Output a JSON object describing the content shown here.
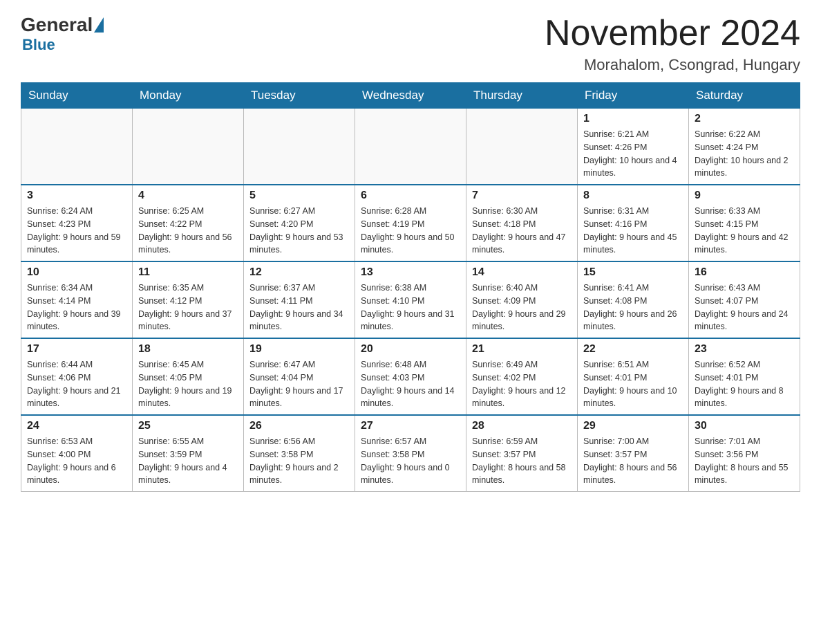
{
  "logo": {
    "general": "General",
    "blue": "Blue"
  },
  "header": {
    "month": "November 2024",
    "location": "Morahalom, Csongrad, Hungary"
  },
  "days_of_week": [
    "Sunday",
    "Monday",
    "Tuesday",
    "Wednesday",
    "Thursday",
    "Friday",
    "Saturday"
  ],
  "weeks": [
    [
      {
        "day": "",
        "info": ""
      },
      {
        "day": "",
        "info": ""
      },
      {
        "day": "",
        "info": ""
      },
      {
        "day": "",
        "info": ""
      },
      {
        "day": "",
        "info": ""
      },
      {
        "day": "1",
        "info": "Sunrise: 6:21 AM\nSunset: 4:26 PM\nDaylight: 10 hours and 4 minutes."
      },
      {
        "day": "2",
        "info": "Sunrise: 6:22 AM\nSunset: 4:24 PM\nDaylight: 10 hours and 2 minutes."
      }
    ],
    [
      {
        "day": "3",
        "info": "Sunrise: 6:24 AM\nSunset: 4:23 PM\nDaylight: 9 hours and 59 minutes."
      },
      {
        "day": "4",
        "info": "Sunrise: 6:25 AM\nSunset: 4:22 PM\nDaylight: 9 hours and 56 minutes."
      },
      {
        "day": "5",
        "info": "Sunrise: 6:27 AM\nSunset: 4:20 PM\nDaylight: 9 hours and 53 minutes."
      },
      {
        "day": "6",
        "info": "Sunrise: 6:28 AM\nSunset: 4:19 PM\nDaylight: 9 hours and 50 minutes."
      },
      {
        "day": "7",
        "info": "Sunrise: 6:30 AM\nSunset: 4:18 PM\nDaylight: 9 hours and 47 minutes."
      },
      {
        "day": "8",
        "info": "Sunrise: 6:31 AM\nSunset: 4:16 PM\nDaylight: 9 hours and 45 minutes."
      },
      {
        "day": "9",
        "info": "Sunrise: 6:33 AM\nSunset: 4:15 PM\nDaylight: 9 hours and 42 minutes."
      }
    ],
    [
      {
        "day": "10",
        "info": "Sunrise: 6:34 AM\nSunset: 4:14 PM\nDaylight: 9 hours and 39 minutes."
      },
      {
        "day": "11",
        "info": "Sunrise: 6:35 AM\nSunset: 4:12 PM\nDaylight: 9 hours and 37 minutes."
      },
      {
        "day": "12",
        "info": "Sunrise: 6:37 AM\nSunset: 4:11 PM\nDaylight: 9 hours and 34 minutes."
      },
      {
        "day": "13",
        "info": "Sunrise: 6:38 AM\nSunset: 4:10 PM\nDaylight: 9 hours and 31 minutes."
      },
      {
        "day": "14",
        "info": "Sunrise: 6:40 AM\nSunset: 4:09 PM\nDaylight: 9 hours and 29 minutes."
      },
      {
        "day": "15",
        "info": "Sunrise: 6:41 AM\nSunset: 4:08 PM\nDaylight: 9 hours and 26 minutes."
      },
      {
        "day": "16",
        "info": "Sunrise: 6:43 AM\nSunset: 4:07 PM\nDaylight: 9 hours and 24 minutes."
      }
    ],
    [
      {
        "day": "17",
        "info": "Sunrise: 6:44 AM\nSunset: 4:06 PM\nDaylight: 9 hours and 21 minutes."
      },
      {
        "day": "18",
        "info": "Sunrise: 6:45 AM\nSunset: 4:05 PM\nDaylight: 9 hours and 19 minutes."
      },
      {
        "day": "19",
        "info": "Sunrise: 6:47 AM\nSunset: 4:04 PM\nDaylight: 9 hours and 17 minutes."
      },
      {
        "day": "20",
        "info": "Sunrise: 6:48 AM\nSunset: 4:03 PM\nDaylight: 9 hours and 14 minutes."
      },
      {
        "day": "21",
        "info": "Sunrise: 6:49 AM\nSunset: 4:02 PM\nDaylight: 9 hours and 12 minutes."
      },
      {
        "day": "22",
        "info": "Sunrise: 6:51 AM\nSunset: 4:01 PM\nDaylight: 9 hours and 10 minutes."
      },
      {
        "day": "23",
        "info": "Sunrise: 6:52 AM\nSunset: 4:01 PM\nDaylight: 9 hours and 8 minutes."
      }
    ],
    [
      {
        "day": "24",
        "info": "Sunrise: 6:53 AM\nSunset: 4:00 PM\nDaylight: 9 hours and 6 minutes."
      },
      {
        "day": "25",
        "info": "Sunrise: 6:55 AM\nSunset: 3:59 PM\nDaylight: 9 hours and 4 minutes."
      },
      {
        "day": "26",
        "info": "Sunrise: 6:56 AM\nSunset: 3:58 PM\nDaylight: 9 hours and 2 minutes."
      },
      {
        "day": "27",
        "info": "Sunrise: 6:57 AM\nSunset: 3:58 PM\nDaylight: 9 hours and 0 minutes."
      },
      {
        "day": "28",
        "info": "Sunrise: 6:59 AM\nSunset: 3:57 PM\nDaylight: 8 hours and 58 minutes."
      },
      {
        "day": "29",
        "info": "Sunrise: 7:00 AM\nSunset: 3:57 PM\nDaylight: 8 hours and 56 minutes."
      },
      {
        "day": "30",
        "info": "Sunrise: 7:01 AM\nSunset: 3:56 PM\nDaylight: 8 hours and 55 minutes."
      }
    ]
  ]
}
